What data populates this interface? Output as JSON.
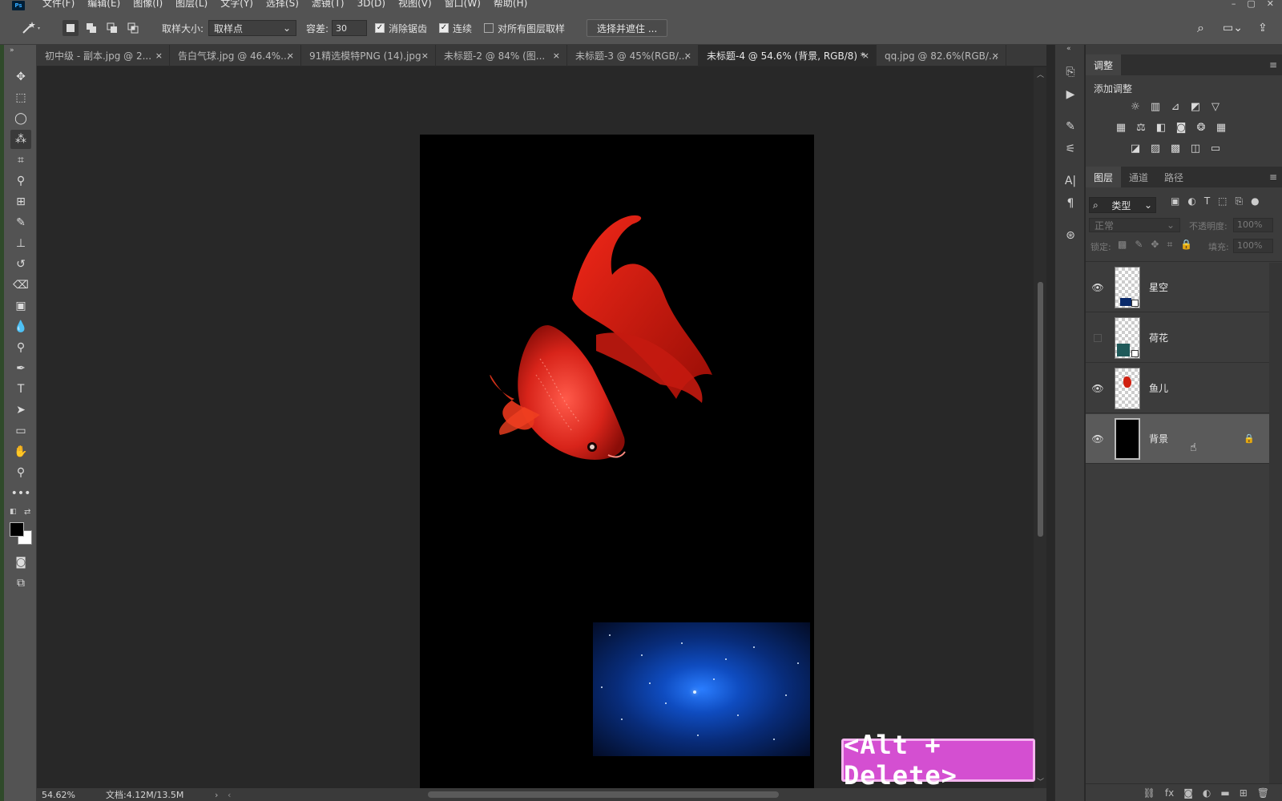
{
  "menu": [
    "文件(F)",
    "编辑(E)",
    "图像(I)",
    "图层(L)",
    "文字(Y)",
    "选择(S)",
    "滤镜(T)",
    "3D(D)",
    "视图(V)",
    "窗口(W)",
    "帮助(H)"
  ],
  "logo": "Ps",
  "options": {
    "sample_size_label": "取样大小:",
    "sample_size_value": "取样点",
    "tolerance_label": "容差:",
    "tolerance_value": "30",
    "antialias_label": "消除锯齿",
    "contiguous_label": "连续",
    "all_layers_label": "对所有图层取样",
    "select_mask_button": "选择并遮住 ..."
  },
  "tabs": [
    {
      "label": "初中级 - 副本.jpg @ 2..."
    },
    {
      "label": "告白气球.jpg @ 46.4%..."
    },
    {
      "label": "91精选模特PNG (14).jpg"
    },
    {
      "label": "未标题-2 @ 84% (图..."
    },
    {
      "label": "未标题-3 @ 45%(RGB/..."
    },
    {
      "label": "未标题-4 @ 54.6% (背景, RGB/8) *"
    },
    {
      "label": "qq.jpg @ 82.6%(RGB/..."
    }
  ],
  "tab_close": "×",
  "status": {
    "zoom": "54.62%",
    "doc": "文档:4.12M/13.5M"
  },
  "key_badge": "<Alt + Delete>",
  "adjustments": {
    "tab": "调整",
    "add_label": "添加调整"
  },
  "layers_panel": {
    "tabs": [
      "图层",
      "通道",
      "路径"
    ],
    "filter_kind": "类型",
    "blend_mode": "正常",
    "opacity_label": "不透明度:",
    "opacity_value": "100%",
    "lock_label": "锁定:",
    "fill_label": "填充:",
    "fill_value": "100%",
    "layers": [
      {
        "name": "星空",
        "visible": true
      },
      {
        "name": "荷花",
        "visible": false
      },
      {
        "name": "鱼儿",
        "visible": true
      },
      {
        "name": "背景",
        "visible": true,
        "locked": true
      }
    ]
  },
  "colors": {
    "accent_badge": "#d44fd1",
    "fish_red": "#e02b1e",
    "star_blue": "#2a7dff"
  }
}
